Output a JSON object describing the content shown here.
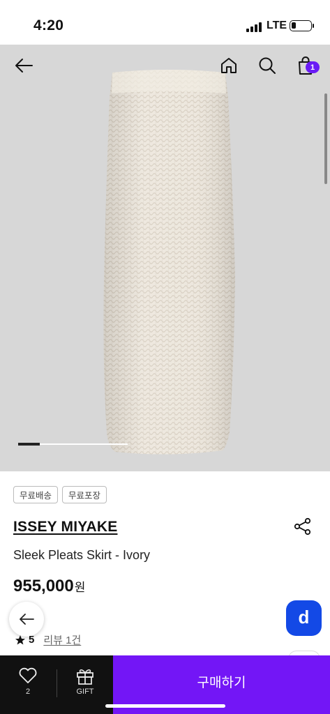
{
  "status_bar": {
    "time": "4:20",
    "network": "LTE",
    "battery_level": 0.22
  },
  "nav": {
    "back_icon": "arrow-left-icon",
    "home_icon": "home-icon",
    "search_icon": "search-icon",
    "cart_icon": "shopping-bag-icon",
    "cart_count": "1"
  },
  "gallery": {
    "current_page": 1,
    "page_count": 5
  },
  "tags": [
    "무료배송",
    "무료포장"
  ],
  "product": {
    "brand": "ISSEY MIYAKE",
    "name": "Sleek Pleats Skirt - Ivory",
    "price": "955,000",
    "currency": "원",
    "rating": "5",
    "reviews_label": "리뷰 1건"
  },
  "bottom_bar": {
    "wishlist_count": "2",
    "gift_label": "GIFT",
    "buy_label": "구매하기"
  },
  "colors": {
    "accent": "#7316f6",
    "d_button": "#1349e6",
    "badge": "#6a1bf5"
  }
}
